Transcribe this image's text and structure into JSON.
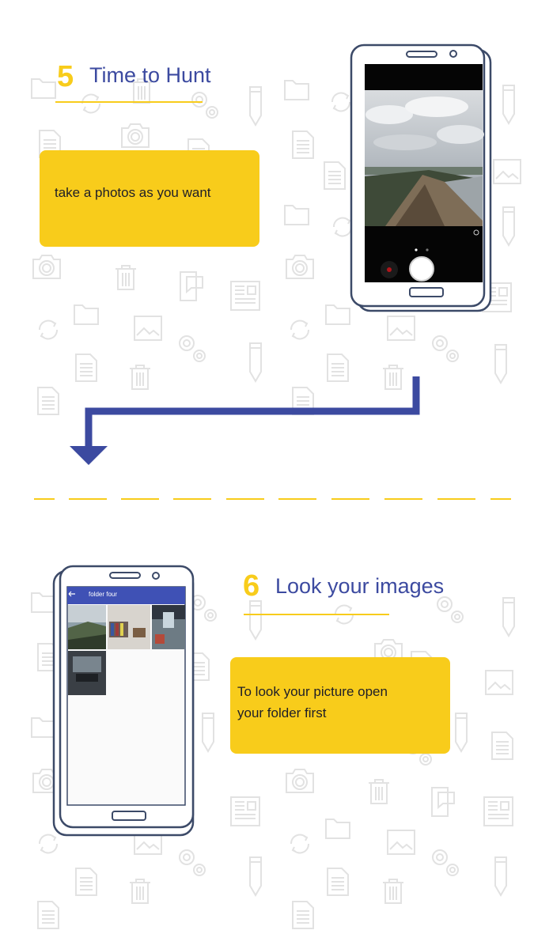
{
  "colors": {
    "yellow": "#f8cc1b",
    "navy": "#3c4aa0",
    "frame": "#3c4a68",
    "pattern": "#e4e4e4",
    "app_bar": "#3f51b5"
  },
  "background": {
    "icon_names": [
      "folder-icon",
      "refresh-icon",
      "trash-icon",
      "gear-icon",
      "pencil-icon",
      "camera-icon",
      "document-icon",
      "image-icon",
      "chat-phone-icon",
      "newspaper-icon"
    ]
  },
  "step5": {
    "number": "5",
    "title": "Time to Hunt",
    "card_text": "take a photos as you want",
    "phone": {
      "viewfinder_page_indicator": {
        "active_index": 0,
        "count": 2
      }
    }
  },
  "step6": {
    "number": "6",
    "title": "Look your images",
    "card_line1": "To look your picture open",
    "card_line2": "your folder first",
    "phone": {
      "app_bar_title": "folder four",
      "thumbnail_count": 4
    }
  }
}
